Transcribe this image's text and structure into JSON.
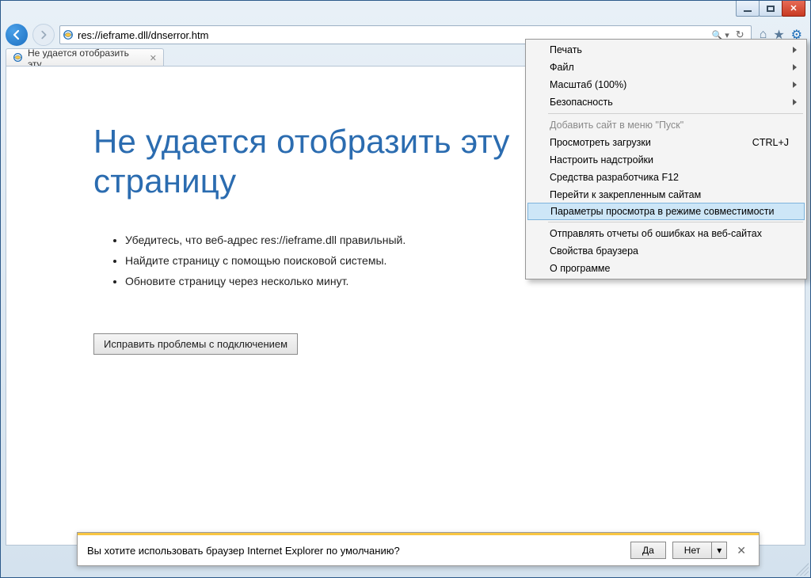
{
  "window": {
    "url": "res://ieframe.dll/dnserror.htm"
  },
  "tab": {
    "title": "Не удается отобразить эту..."
  },
  "toolbar": {
    "search_glyph": "🔍",
    "refresh_glyph": "↻",
    "home_glyph": "⌂",
    "star_glyph": "★",
    "gear_glyph": "⚙"
  },
  "error": {
    "title_line1": "Не удается отобразить эту",
    "title_line2": "страницу",
    "bullets": [
      "Убедитесь, что веб-адрес res://ieframe.dll правильный.",
      "Найдите страницу с помощью поисковой системы.",
      "Обновите страницу через несколько минут."
    ],
    "fix_button": "Исправить проблемы с подключением"
  },
  "menu": {
    "items": [
      {
        "label": "Печать",
        "submenu": true
      },
      {
        "label": "Файл",
        "submenu": true
      },
      {
        "label": "Масштаб (100%)",
        "submenu": true
      },
      {
        "label": "Безопасность",
        "submenu": true
      },
      {
        "sep": true
      },
      {
        "label": "Добавить сайт в меню \"Пуск\"",
        "disabled": true
      },
      {
        "label": "Просмотреть загрузки",
        "shortcut": "CTRL+J"
      },
      {
        "label": "Настроить надстройки"
      },
      {
        "label": "Средства разработчика F12"
      },
      {
        "label": "Перейти к закрепленным сайтам"
      },
      {
        "label": "Параметры просмотра в режиме совместимости",
        "highlight": true
      },
      {
        "sep": true
      },
      {
        "label": "Отправлять отчеты об ошибках на веб-сайтах"
      },
      {
        "label": "Свойства браузера"
      },
      {
        "label": "О программе"
      }
    ]
  },
  "infobar": {
    "text": "Вы хотите использовать браузер Internet Explorer по умолчанию?",
    "yes": "Да",
    "no": "Нет"
  }
}
